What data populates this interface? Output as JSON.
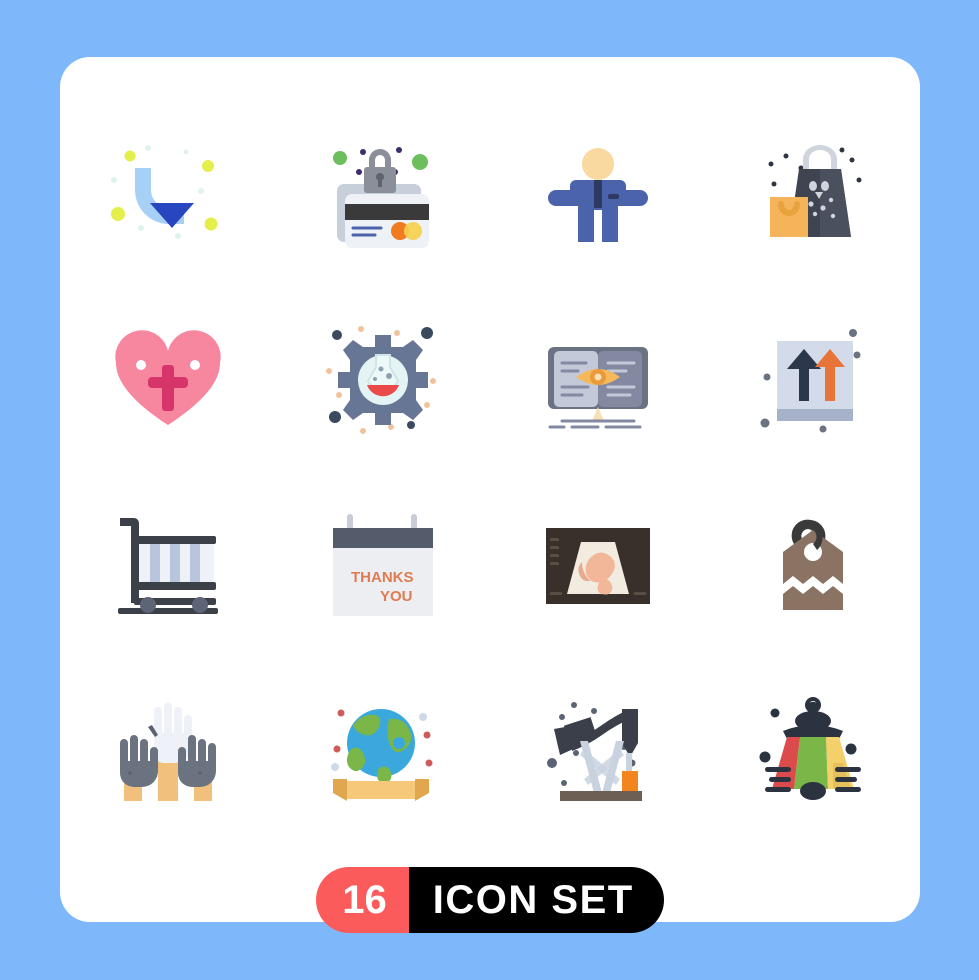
{
  "page": {
    "background_color": "#7eb8fb",
    "card_color": "#ffffff"
  },
  "badge": {
    "count": "16",
    "label": "ICON SET",
    "count_bg_color": "#fc5b5b",
    "label_bg_color": "#000000",
    "text_color": "#ffffff"
  },
  "grid": {
    "columns": 4,
    "rows": 4,
    "total_icons": 16
  },
  "icons": [
    {
      "index": 1,
      "name": "curved-down-arrow-icon",
      "label": "Curved Down Arrow",
      "colors": [
        "#a7d0f7",
        "#2746c0",
        "#e4ef4b",
        "#dff2ef"
      ]
    },
    {
      "index": 2,
      "name": "secure-credit-card-icon",
      "label": "Secure Credit Card",
      "colors": [
        "#dde3ec",
        "#7b7f8a",
        "#3b3b3b",
        "#f07b21",
        "#f6d04d",
        "#6dbf5e",
        "#3b2f6b"
      ]
    },
    {
      "index": 3,
      "name": "businessman-icon",
      "label": "Businessman",
      "colors": [
        "#4a63ab",
        "#fad9a0",
        "#2f3a63"
      ]
    },
    {
      "index": 4,
      "name": "shopping-bags-icon",
      "label": "Shopping Bags",
      "colors": [
        "#3e4450",
        "#575e6b",
        "#f5b45a",
        "#cfd4dd",
        "#2f3540"
      ]
    },
    {
      "index": 5,
      "name": "heart-cross-icon",
      "label": "Heart With Cross",
      "colors": [
        "#f7879f",
        "#d6356a",
        "#ffffff"
      ]
    },
    {
      "index": 6,
      "name": "gear-flask-icon",
      "label": "Research Gear Flask",
      "colors": [
        "#667694",
        "#e4f3f4",
        "#ea4a4a",
        "#3b4a5e",
        "#f0c39a"
      ]
    },
    {
      "index": 7,
      "name": "book-eye-icon",
      "label": "Open Book With Eye",
      "colors": [
        "#c3c9d9",
        "#8289a0",
        "#6a7283",
        "#f5b95c",
        "#f6e0b4"
      ]
    },
    {
      "index": 8,
      "name": "this-side-up-box-icon",
      "label": "This Side Up Package",
      "colors": [
        "#d3daea",
        "#a6b2c9",
        "#2c374c",
        "#e8743a",
        "#6b7280"
      ]
    },
    {
      "index": 9,
      "name": "platform-trolley-icon",
      "label": "Platform Trolley Cart",
      "colors": [
        "#3c4049",
        "#eef1f7",
        "#b9c4dd",
        "#5c6475"
      ]
    },
    {
      "index": 10,
      "name": "thank-you-card-icon",
      "label": "Thank You Card",
      "colors": [
        "#eceef1",
        "#545b6b",
        "#c7ccd6",
        "#e07b51"
      ],
      "text_lines": [
        "THANKS",
        "YOU"
      ]
    },
    {
      "index": 11,
      "name": "ultrasound-scan-icon",
      "label": "Ultrasound Scan",
      "colors": [
        "#3a302b",
        "#f2ece0",
        "#f2b798",
        "#e8a98c"
      ]
    },
    {
      "index": 12,
      "name": "price-tag-icon",
      "label": "Price Tag Label",
      "colors": [
        "#8a7362",
        "#3a3a3a",
        "#ffffff"
      ]
    },
    {
      "index": 13,
      "name": "raised-hands-icon",
      "label": "Raised Hands",
      "colors": [
        "#6b7280",
        "#eef1f7",
        "#f0c07c",
        "#5a6170"
      ]
    },
    {
      "index": 14,
      "name": "globe-ribbon-icon",
      "label": "Globe With Ribbon",
      "colors": [
        "#3aa8dc",
        "#7ab648",
        "#f5c87a",
        "#e0a74f",
        "#cf5a5a",
        "#cdd8e8"
      ]
    },
    {
      "index": 15,
      "name": "oil-pump-jack-icon",
      "label": "Oil Pump Jack",
      "colors": [
        "#3a3f49",
        "#c9d2df",
        "#f2851e",
        "#6d5f53",
        "#5b6475"
      ]
    },
    {
      "index": 16,
      "name": "lantern-icon",
      "label": "Colorful Lantern",
      "colors": [
        "#2c3340",
        "#dc4b4b",
        "#7ab648",
        "#f3d06a",
        "#e3c05c"
      ]
    }
  ]
}
